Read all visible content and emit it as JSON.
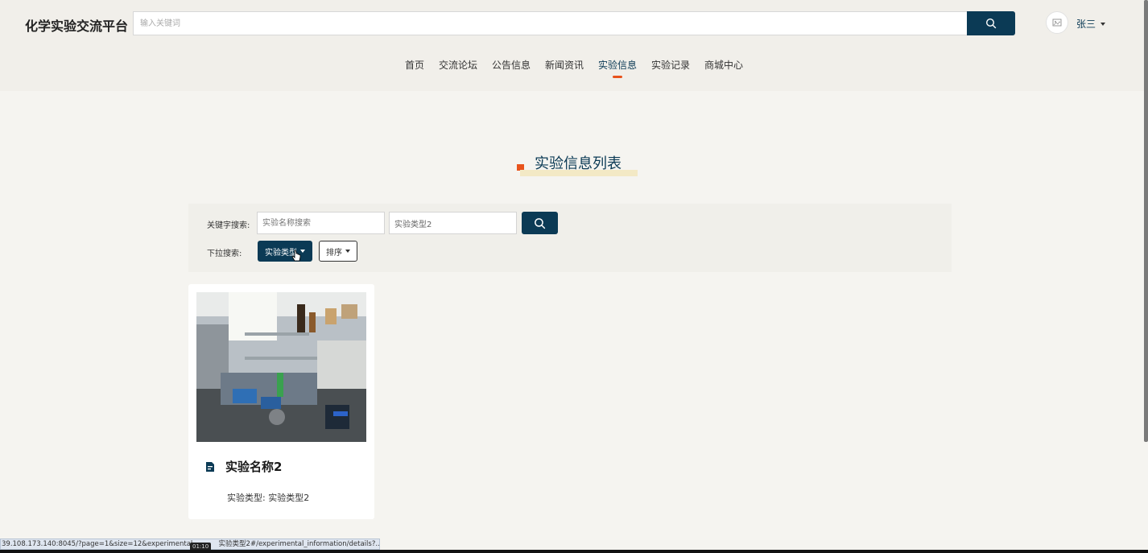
{
  "header": {
    "brand": "化学实验交流平台",
    "search_placeholder": "输入关键词",
    "username": "张三"
  },
  "nav": {
    "items": [
      "首页",
      "交流论坛",
      "公告信息",
      "新闻资讯",
      "实验信息",
      "实验记录",
      "商城中心"
    ],
    "active": "实验信息"
  },
  "section": {
    "title": "实验信息列表"
  },
  "filters": {
    "keyword_label": "关键字搜索:",
    "name_placeholder": "实验名称搜索",
    "type_value": "实验类型2",
    "dropdown_label": "下拉搜索:",
    "type_dropdown": "实验类型",
    "sort_dropdown": "排序"
  },
  "cards": [
    {
      "title": "实验名称2",
      "meta": "实验类型: 实验类型2"
    }
  ],
  "status_bar": {
    "url": "39.108.173.140:8045/?page=1&size=12&experimental_",
    "url_tail": "实验类型2#/experimental_information/details?..."
  },
  "timestamp": "01:10",
  "colors": {
    "primary": "#0b3a55",
    "accent": "#e8531c",
    "background": "#f5f4f0"
  }
}
